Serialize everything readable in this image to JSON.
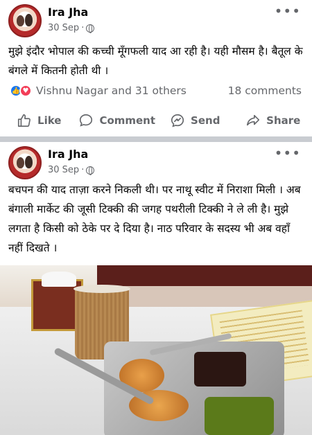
{
  "posts": [
    {
      "author": "Ira Jha",
      "date": "30 Sep",
      "dot": "·",
      "more": "•••",
      "text": "मुझे इंदौर भोपाल की कच्ची मूँगफली याद आ रही है। यही मौसम है। बैतूल के बंगले में कितनी होती थी ।",
      "reactions_text": "Vishnu Nagar and 31 others",
      "comments_text": "18 comments",
      "actions": {
        "like": "Like",
        "comment": "Comment",
        "send": "Send",
        "share": "Share"
      }
    },
    {
      "author": "Ira Jha",
      "date": "30 Sep",
      "dot": "·",
      "more": "•••",
      "text": "बचपन की याद ताज़ा करने निकली थी। पर नाथू स्वीट में निराशा मिली । अब बंगाली मार्केट की जूसी टिक्की की जगह पथरीली टिक्की ने ले ली है। मुझे लगता है किसी को ठेके पर दे दिया है। नाठ परिवार के सदस्य भी अब वहाँ नहीं दिखते ।"
    }
  ],
  "icons": {
    "like": "thumbs-up-icon",
    "comment": "comment-bubble-icon",
    "send": "messenger-send-icon",
    "share": "share-arrow-icon",
    "privacy": "globe-icon"
  },
  "colors": {
    "like_blue": "#1877f2",
    "love_red": "#f33e58",
    "muted": "#65676b"
  }
}
